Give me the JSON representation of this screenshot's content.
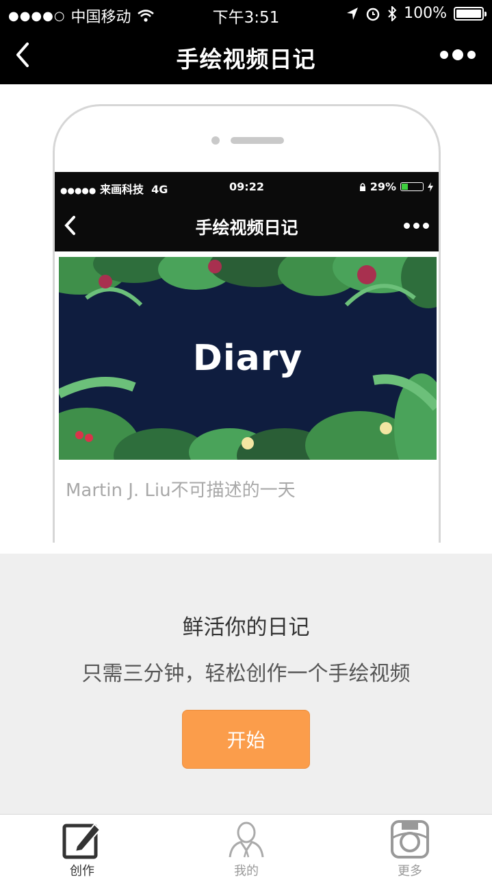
{
  "status_bar": {
    "signal": "●●●●○",
    "carrier": "中国移动",
    "time": "下午3:51",
    "battery": "100%",
    "battery_level": 1.0
  },
  "nav": {
    "title": "手绘视频日记",
    "back_icon": "chevron-left-icon",
    "more_icon": "more-dots-icon"
  },
  "mockup": {
    "status": {
      "signal": "●●●●●",
      "carrier": "来画科技",
      "network": "4G",
      "time": "09:22",
      "battery": "29%",
      "battery_level": 0.29
    },
    "nav_title": "手绘视频日记",
    "banner_word": "Diary",
    "caption": "Martin J. Liu不可描述的一天"
  },
  "promo": {
    "heading": "鲜活你的日记",
    "subheading": "只需三分钟，轻松创作一个手绘视频",
    "start_label": "开始",
    "accent": "#fb9d4b"
  },
  "tabs": [
    {
      "label": "创作",
      "icon": "edit-icon",
      "active": true
    },
    {
      "label": "我的",
      "icon": "user-icon",
      "active": false
    },
    {
      "label": "更多",
      "icon": "camera-icon",
      "active": false
    }
  ]
}
